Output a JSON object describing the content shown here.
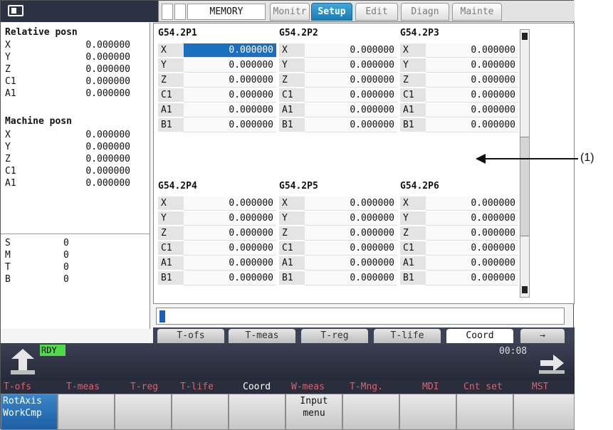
{
  "header": {
    "mode": "MEMORY",
    "tabs": [
      {
        "label": "Monitr",
        "active": false
      },
      {
        "label": "Setup",
        "active": true
      },
      {
        "label": "Edit",
        "active": false
      },
      {
        "label": "Diagn",
        "active": false
      },
      {
        "label": "Mainte",
        "active": false
      }
    ]
  },
  "left_panel": {
    "relative_title": "Relative posn",
    "relative": [
      {
        "axis": "X",
        "value": "0.000000"
      },
      {
        "axis": "Y",
        "value": "0.000000"
      },
      {
        "axis": "Z",
        "value": "0.000000"
      },
      {
        "axis": "C1",
        "value": "0.000000"
      },
      {
        "axis": "A1",
        "value": "0.000000"
      }
    ],
    "machine_title": "Machine posn",
    "machine": [
      {
        "axis": "X",
        "value": "0.000000"
      },
      {
        "axis": "Y",
        "value": "0.000000"
      },
      {
        "axis": "Z",
        "value": "0.000000"
      },
      {
        "axis": "C1",
        "value": "0.000000"
      },
      {
        "axis": "A1",
        "value": "0.000000"
      }
    ],
    "smtb": [
      {
        "axis": "S",
        "value": "0"
      },
      {
        "axis": "M",
        "value": "0"
      },
      {
        "axis": "T",
        "value": "0"
      },
      {
        "axis": "B",
        "value": "0"
      }
    ]
  },
  "offsets": [
    {
      "title": "G54.2P1",
      "rows": [
        [
          "X",
          "0.000000"
        ],
        [
          "Y",
          "0.000000"
        ],
        [
          "Z",
          "0.000000"
        ],
        [
          "C1",
          "0.000000"
        ],
        [
          "A1",
          "0.000000"
        ],
        [
          "B1",
          "0.000000"
        ]
      ]
    },
    {
      "title": "G54.2P2",
      "rows": [
        [
          "X",
          "0.000000"
        ],
        [
          "Y",
          "0.000000"
        ],
        [
          "Z",
          "0.000000"
        ],
        [
          "C1",
          "0.000000"
        ],
        [
          "A1",
          "0.000000"
        ],
        [
          "B1",
          "0.000000"
        ]
      ]
    },
    {
      "title": "G54.2P3",
      "rows": [
        [
          "X",
          "0.000000"
        ],
        [
          "Y",
          "0.000000"
        ],
        [
          "Z",
          "0.000000"
        ],
        [
          "C1",
          "0.000000"
        ],
        [
          "A1",
          "0.000000"
        ],
        [
          "B1",
          "0.000000"
        ]
      ]
    },
    {
      "title": "G54.2P4",
      "rows": [
        [
          "X",
          "0.000000"
        ],
        [
          "Y",
          "0.000000"
        ],
        [
          "Z",
          "0.000000"
        ],
        [
          "C1",
          "0.000000"
        ],
        [
          "A1",
          "0.000000"
        ],
        [
          "B1",
          "0.000000"
        ]
      ]
    },
    {
      "title": "G54.2P5",
      "rows": [
        [
          "X",
          "0.000000"
        ],
        [
          "Y",
          "0.000000"
        ],
        [
          "Z",
          "0.000000"
        ],
        [
          "C1",
          "0.000000"
        ],
        [
          "A1",
          "0.000000"
        ],
        [
          "B1",
          "0.000000"
        ]
      ]
    },
    {
      "title": "G54.2P6",
      "rows": [
        [
          "X",
          "0.000000"
        ],
        [
          "Y",
          "0.000000"
        ],
        [
          "Z",
          "0.000000"
        ],
        [
          "C1",
          "0.000000"
        ],
        [
          "A1",
          "0.000000"
        ],
        [
          "B1",
          "0.000000"
        ]
      ]
    }
  ],
  "bottom_tabs": [
    {
      "label": "T-ofs",
      "active": false
    },
    {
      "label": "T-meas",
      "active": false
    },
    {
      "label": "T-reg",
      "active": false
    },
    {
      "label": "T-life",
      "active": false
    },
    {
      "label": "Coord",
      "active": true
    },
    {
      "label": "→",
      "active": false
    }
  ],
  "status": {
    "ready": "RDY",
    "clock": "00:08"
  },
  "menu_labels": [
    {
      "label": "T-ofs",
      "active": false
    },
    {
      "label": "T-meas",
      "active": false
    },
    {
      "label": "T-reg",
      "active": false
    },
    {
      "label": "T-life",
      "active": false
    },
    {
      "label": "Coord",
      "active": true
    },
    {
      "label": "W-meas",
      "active": false
    },
    {
      "label": "T-Mng.",
      "active": false
    },
    {
      "label": "MDI",
      "active": false
    },
    {
      "label": "Cnt set",
      "active": false
    },
    {
      "label": "MST",
      "active": false
    }
  ],
  "function_keys": [
    {
      "line1": "RotAxis",
      "line2": "WorkCmp"
    },
    {
      "line1": "",
      "line2": ""
    },
    {
      "line1": "",
      "line2": ""
    },
    {
      "line1": "",
      "line2": ""
    },
    {
      "line1": "",
      "line2": ""
    },
    {
      "line1": "Input",
      "line2": "menu"
    },
    {
      "line1": "",
      "line2": ""
    },
    {
      "line1": "",
      "line2": ""
    },
    {
      "line1": "",
      "line2": ""
    },
    {
      "line1": "",
      "line2": ""
    }
  ],
  "callout": "(1)"
}
